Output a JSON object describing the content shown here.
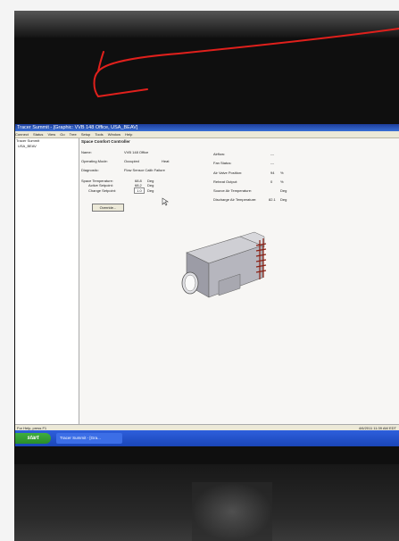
{
  "window": {
    "title": "Tracer Summit - [Graphic:  VVB 148 Office, USA_BEAV]"
  },
  "menu": [
    "Connect",
    "Status",
    "View",
    "Go",
    "Tree",
    "Setup",
    "Tools",
    "Window",
    "Help"
  ],
  "sidebar": {
    "items": [
      "Tracer Summit",
      "USA_BEAV"
    ]
  },
  "panel": {
    "title": "Space Comfort Controller",
    "left_fields": [
      {
        "label": "Name:",
        "value": "VVB 148 Office"
      },
      {
        "label": "Operating Mode:",
        "value": "Occupied",
        "extra": "Heat"
      },
      {
        "label": "Diagnostic:",
        "value": "Flow Sensor Calib Failure"
      }
    ],
    "temps": [
      {
        "label": "Space Temperature:",
        "value": "68.8",
        "unit": "Deg"
      },
      {
        "label": "Active Setpoint:",
        "value": "68.2",
        "unit": "Deg"
      },
      {
        "label": "Change Setpoint:",
        "value": "1.0",
        "unit": "Deg"
      }
    ],
    "override_label": "Override...",
    "right_fields": [
      {
        "label": "Airflow:",
        "value": "---",
        "unit": ""
      },
      {
        "label": "Fan Status:",
        "value": "---",
        "unit": ""
      },
      {
        "label": "Air Valve Position:",
        "value": "94",
        "unit": "%"
      },
      {
        "label": "Reheat Output:",
        "value": "0",
        "unit": "%"
      },
      {
        "label": "Source Air Temperature:",
        "value": "",
        "unit": "Deg"
      },
      {
        "label": "Discharge Air Temperature:",
        "value": "82.1",
        "unit": "Deg"
      }
    ]
  },
  "status": {
    "left": "For Help, press F1",
    "right": "4/6/2011 11:39 AM EDT"
  },
  "taskbar": {
    "start_label": "start",
    "task_label": "Tracer Summit - [Gra..."
  },
  "colors": {
    "titlebar": "#1c3d9a",
    "menubar": "#ece9d8",
    "taskbar": "#1a46b8",
    "start": "#2a8c2a",
    "ink": "#e0201c"
  },
  "icons": {
    "equipment": "vav-box-icon"
  }
}
